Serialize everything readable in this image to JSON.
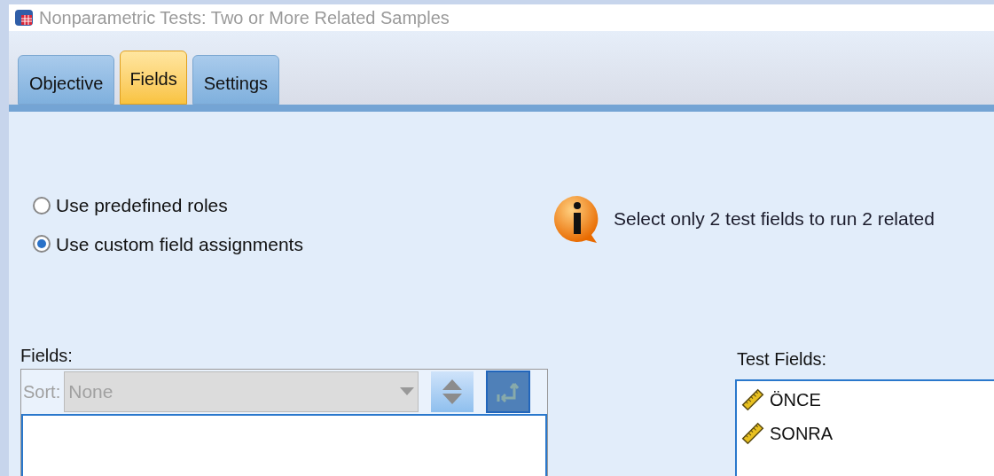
{
  "window": {
    "title": "Nonparametric Tests: Two or More Related Samples"
  },
  "tabs": [
    {
      "label": "Objective",
      "selected": false
    },
    {
      "label": "Fields",
      "selected": true
    },
    {
      "label": "Settings",
      "selected": false
    }
  ],
  "radios": [
    {
      "label": "Use predefined roles",
      "selected": false
    },
    {
      "label": "Use custom field assignments",
      "selected": true
    }
  ],
  "info": {
    "message": "Select only 2 test fields to run 2 related"
  },
  "fields": {
    "label": "Fields:",
    "sort_label": "Sort:",
    "sort_value": "None",
    "disabled": true
  },
  "test_fields": {
    "label": "Test Fields:",
    "items": [
      {
        "name": "ÖNCE"
      },
      {
        "name": "SONRA"
      }
    ]
  }
}
